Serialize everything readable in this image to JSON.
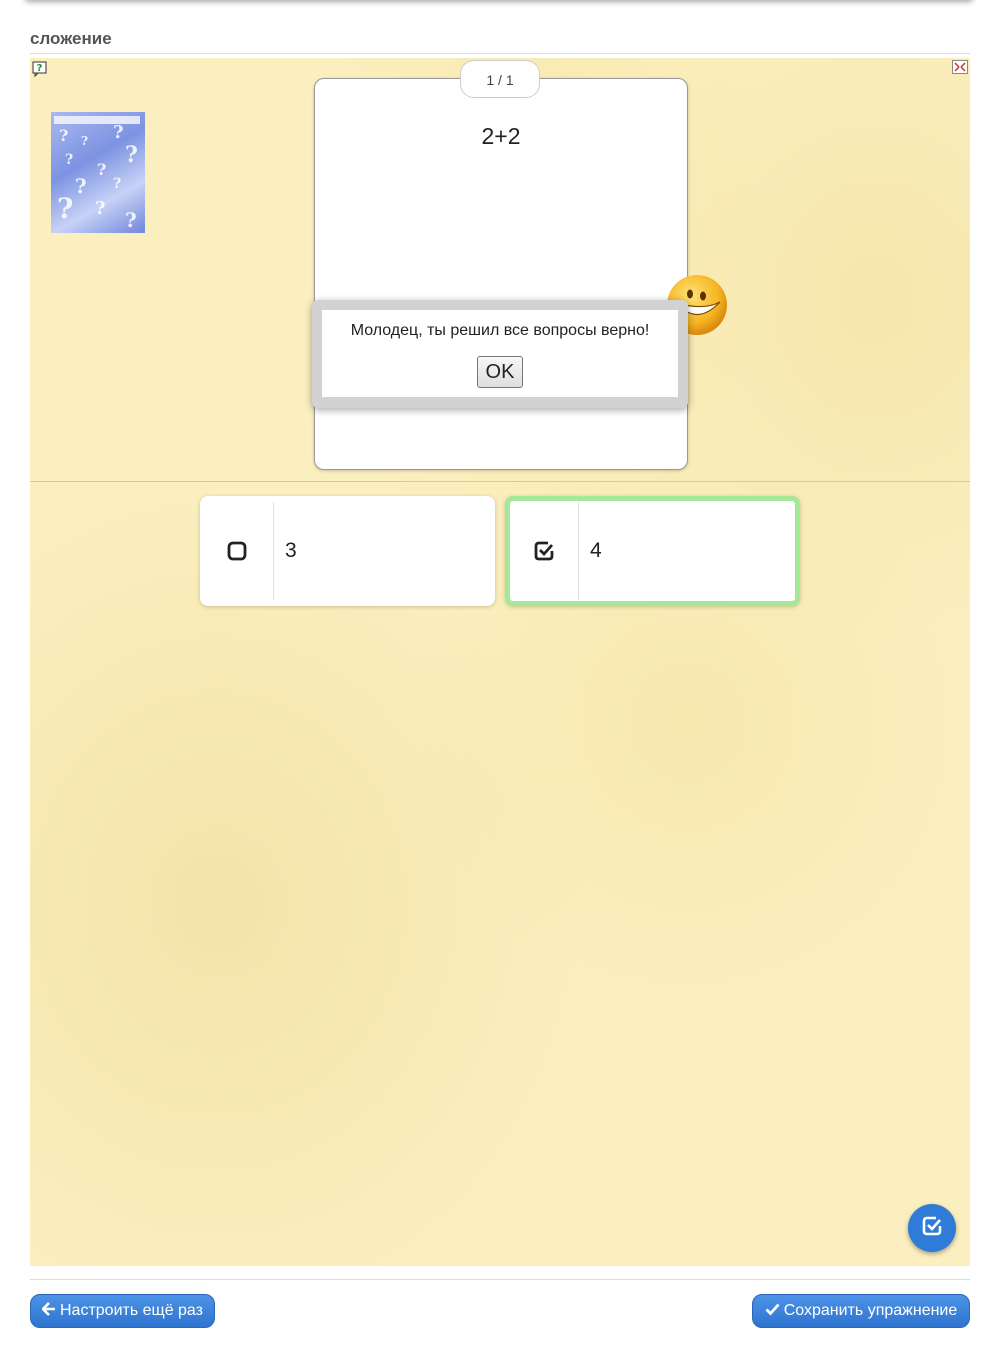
{
  "exercise": {
    "title": "сложение"
  },
  "card": {
    "counter": "1 / 1",
    "question": "2+2"
  },
  "dialog": {
    "message": "Молодец, ты решил все вопросы верно!",
    "ok_label": "OK"
  },
  "answers": [
    {
      "label": "3",
      "checked": false
    },
    {
      "label": "4",
      "checked": true
    }
  ],
  "footer": {
    "back_label": "Настроить ещё раз",
    "save_label": "Сохранить упражнение"
  },
  "colors": {
    "accent": "#2f7bd8",
    "correct_border": "#a6e89a",
    "background": "#fbefbf"
  },
  "icons": [
    "help-icon",
    "fullscreen-icon",
    "smiley-icon",
    "checkbox-empty-icon",
    "checkbox-checked-icon",
    "check-icon",
    "arrow-left-icon"
  ]
}
